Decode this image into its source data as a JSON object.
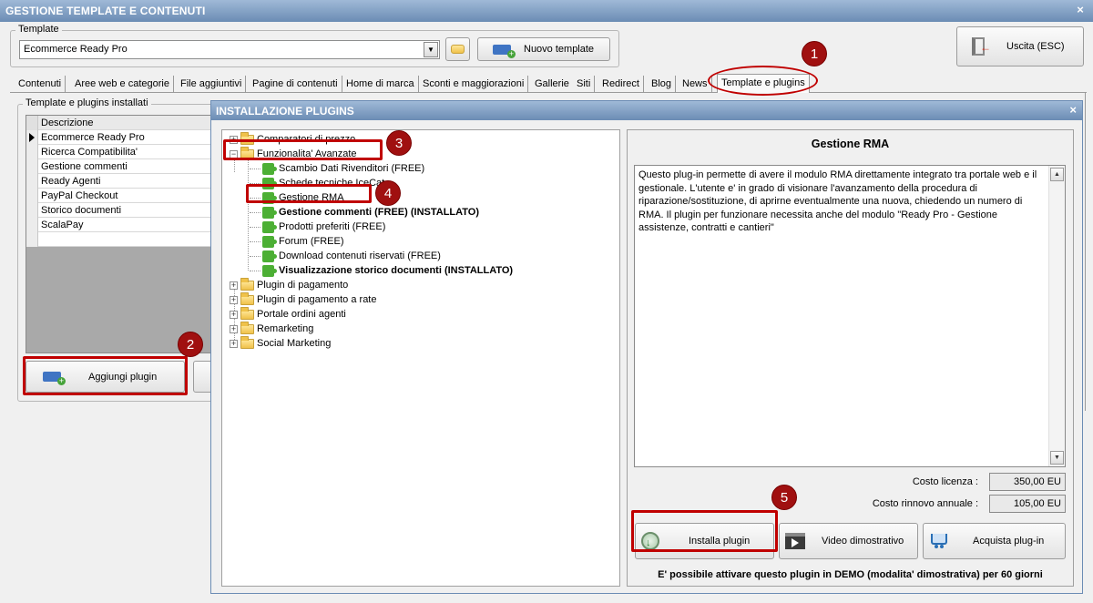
{
  "window": {
    "title": "GESTIONE TEMPLATE E CONTENUTI",
    "close": "×"
  },
  "template_group": {
    "label": "Template",
    "combo_value": "Ecommerce Ready Pro",
    "nuovo_label": "Nuovo template"
  },
  "exit_button": {
    "label": "Uscita (ESC)"
  },
  "tabs": [
    {
      "label": "Contenuti"
    },
    {
      "label": "Aree web e categorie"
    },
    {
      "label": "File aggiuntivi"
    },
    {
      "label": "Pagine di contenuti"
    },
    {
      "label": "Home di marca"
    },
    {
      "label": "Sconti e maggiorazioni"
    },
    {
      "label": "Gallerie"
    },
    {
      "label": "Siti"
    },
    {
      "label": "Redirect"
    },
    {
      "label": "Blog"
    },
    {
      "label": "News"
    },
    {
      "label": "Template e plugins"
    }
  ],
  "installed": {
    "group_label": "Template e plugins installati",
    "column": "Descrizione",
    "rows": [
      "Ecommerce Ready Pro",
      "Ricerca Compatibilita'",
      "Gestione commenti",
      "Ready Agenti",
      "PayPal Checkout",
      "Storico documenti",
      "ScalaPay"
    ],
    "add_button": "Aggiungi plugin"
  },
  "dialog": {
    "title": "INSTALLAZIONE PLUGINS",
    "close": "×",
    "tree": {
      "comparatori": "Comparatori di prezzo",
      "funzionalita": "Funzionalita' Avanzate",
      "children": [
        {
          "label": "Scambio Dati Rivenditori (FREE)",
          "bold": false
        },
        {
          "label": "Schede tecniche IceCat",
          "bold": false
        },
        {
          "label": "Gestione RMA",
          "bold": false
        },
        {
          "label": "Gestione commenti (FREE) (INSTALLATO)",
          "bold": true
        },
        {
          "label": "Prodotti preferiti (FREE)",
          "bold": false
        },
        {
          "label": "Forum (FREE)",
          "bold": false
        },
        {
          "label": "Download contenuti riservati (FREE)",
          "bold": false
        },
        {
          "label": "Visualizzazione storico documenti (INSTALLATO)",
          "bold": true
        }
      ],
      "others": [
        "Plugin di pagamento",
        "Plugin di pagamento a rate",
        "Portale ordini agenti",
        "Remarketing",
        "Social Marketing"
      ]
    },
    "detail": {
      "title": "Gestione RMA",
      "description": "Questo plug-in permette di avere il modulo RMA direttamente integrato tra portale web e il gestionale. L'utente e' in grado di visionare l'avanzamento della procedura di riparazione/sostituzione, di aprirne eventualmente una nuova, chiedendo un numero di RMA. Il plugin per funzionare necessita anche del modulo \"Ready Pro - Gestione assistenze, contratti e cantieri\"",
      "costo_licenza_label": "Costo licenza :",
      "costo_licenza": "350,00 EU",
      "costo_rinnovo_label": "Costo rinnovo annuale :",
      "costo_rinnovo": "105,00 EU",
      "installa": "Installa plugin",
      "video": "Video dimostrativo",
      "acquista": "Acquista plug-in",
      "demo_note": "E' possibile attivare questo plugin in DEMO (modalita' dimostrativa) per 60 giorni"
    }
  },
  "annotations": [
    "1",
    "2",
    "3",
    "4",
    "5"
  ],
  "colors": {
    "titlebar": "#7a98bf",
    "highlight": "#c00000",
    "badge": "#a01010",
    "puzzle": "#4caf34"
  }
}
